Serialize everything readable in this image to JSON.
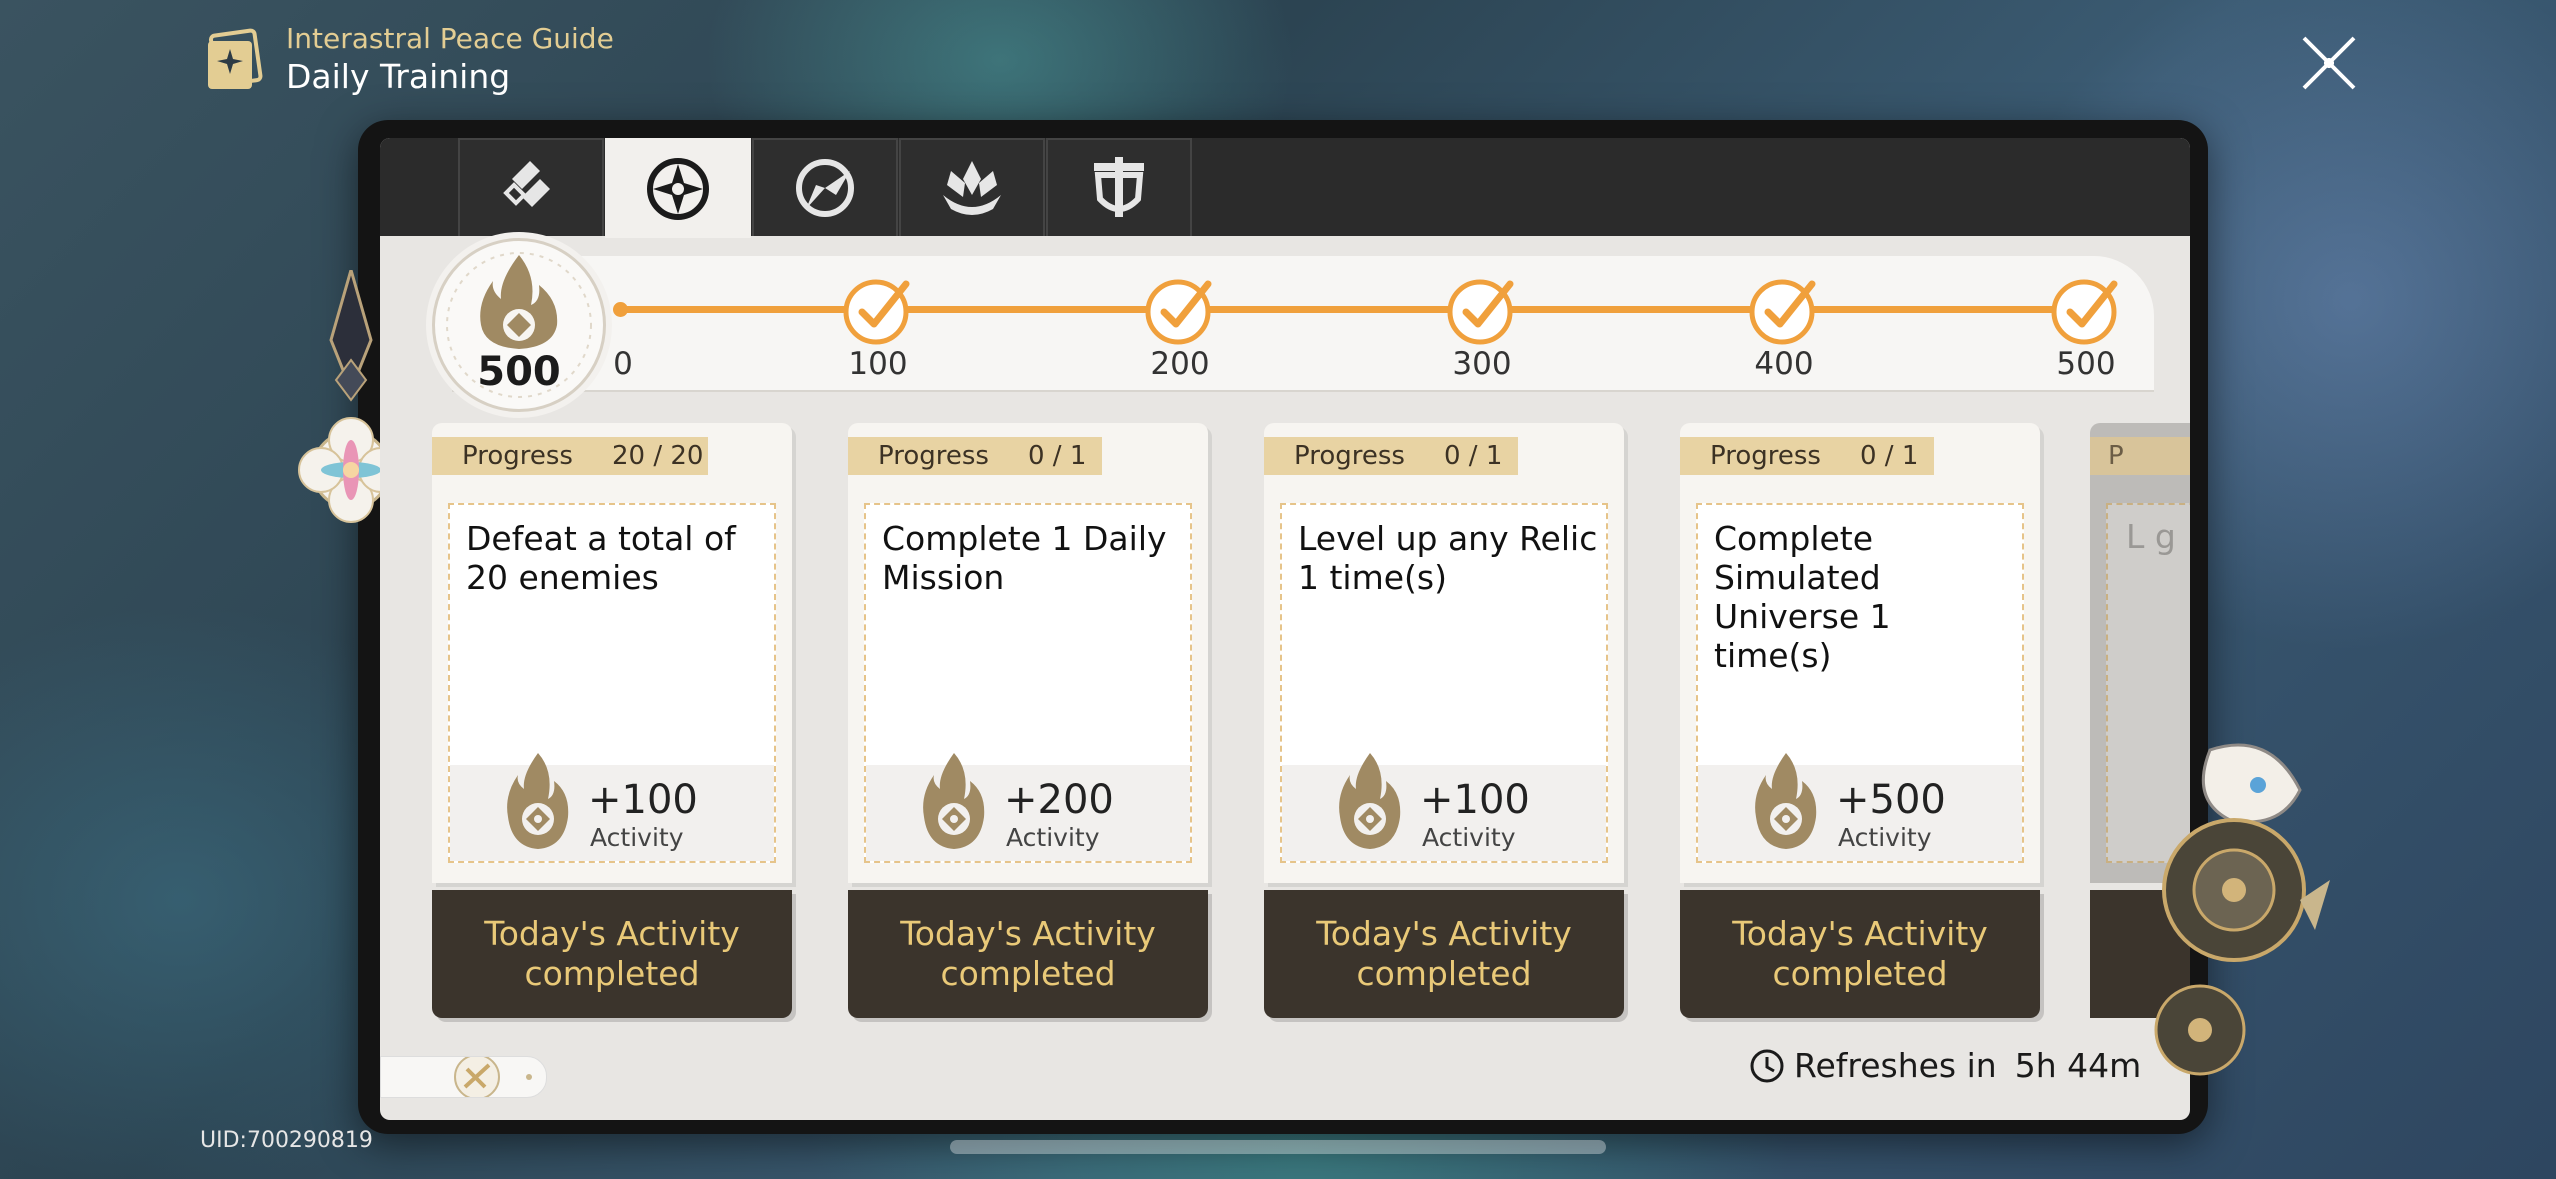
{
  "header": {
    "subtitle": "Interastral Peace Guide",
    "title": "Daily Training",
    "icon": "guide-book-icon"
  },
  "close_icon": "close-x-icon",
  "uid": "UID:700290819",
  "tabs": [
    {
      "icon": "operation-icon",
      "active": false
    },
    {
      "icon": "daily-training-icon",
      "active": true
    },
    {
      "icon": "seasonal-icon",
      "active": false
    },
    {
      "icon": "treasures-icon",
      "active": false
    },
    {
      "icon": "survival-icon",
      "active": false
    }
  ],
  "activity": {
    "current": "500",
    "milestones": [
      "0",
      "100",
      "200",
      "300",
      "400",
      "500"
    ],
    "claimed": [
      false,
      true,
      true,
      true,
      true,
      true
    ],
    "accent_color": "#f0a03c"
  },
  "cards": [
    {
      "progress_label": "Progress",
      "progress_value": "20 / 20",
      "task": "Defeat a total of 20 enemies",
      "reward_value": "+100",
      "reward_label": "Activity",
      "status": "Today's Activity completed"
    },
    {
      "progress_label": "Progress",
      "progress_value": "0 / 1",
      "task": "Complete 1 Daily Mission",
      "reward_value": "+200",
      "reward_label": "Activity",
      "status": "Today's Activity completed"
    },
    {
      "progress_label": "Progress",
      "progress_value": "0 / 1",
      "task": "Level up any Relic 1 time(s)",
      "reward_value": "+100",
      "reward_label": "Activity",
      "status": "Today's Activity completed"
    },
    {
      "progress_label": "Progress",
      "progress_value": "0 / 1",
      "task": "Complete Simulated Universe 1 time(s)",
      "reward_value": "+500",
      "reward_label": "Activity",
      "status": "Today's Activity completed"
    }
  ],
  "partial_card": {
    "progress_fragment": "P",
    "task_fragment": "L g"
  },
  "refresh": {
    "label": "Refreshes in",
    "time": "5h 44m"
  }
}
